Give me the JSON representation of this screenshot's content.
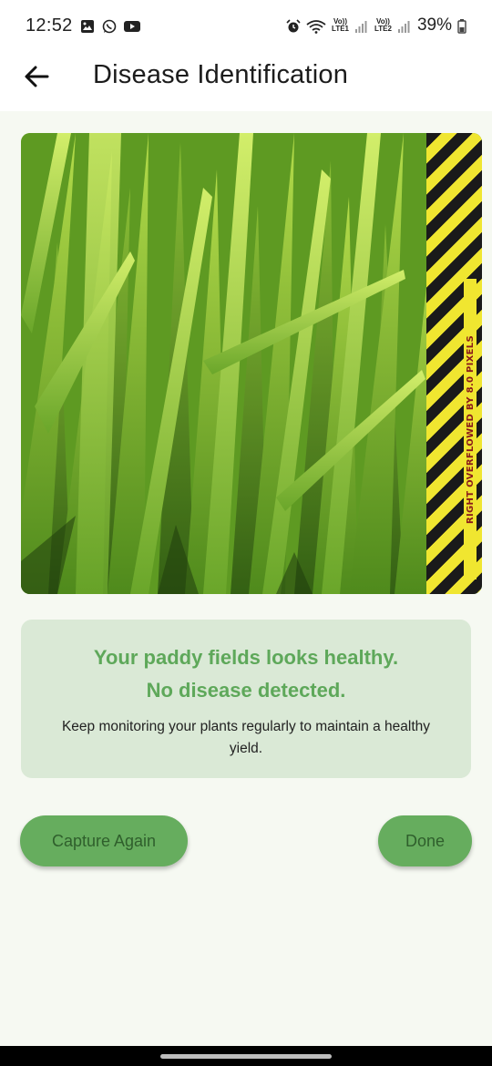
{
  "status_bar": {
    "time": "12:52",
    "network_1": "LTE1",
    "network_2": "LTE2",
    "volte_1": "Vo))",
    "volte_2": "Vo))",
    "battery": "39%",
    "icons": [
      "gallery-icon",
      "whatsapp-icon",
      "youtube-icon",
      "alarm-icon",
      "wifi-icon",
      "signal-icon",
      "battery-icon"
    ]
  },
  "app_bar": {
    "back_icon": "arrow-left-icon",
    "title": "Disease Identification"
  },
  "photo": {
    "overflow_warning": "RIGHT OVERFLOWED BY 8.0 PIXELS"
  },
  "result": {
    "title_line1": "Your paddy fields looks healthy.",
    "title_line2": "No disease detected.",
    "description": "Keep monitoring your plants regularly to maintain a healthy yield."
  },
  "actions": {
    "capture_again": "Capture Again",
    "done": "Done"
  },
  "colors": {
    "background": "#f6f9f2",
    "card": "#dae9d6",
    "accent_green": "#5ea85a",
    "button_green": "#66ad5e",
    "button_text": "#2f5f2c"
  }
}
